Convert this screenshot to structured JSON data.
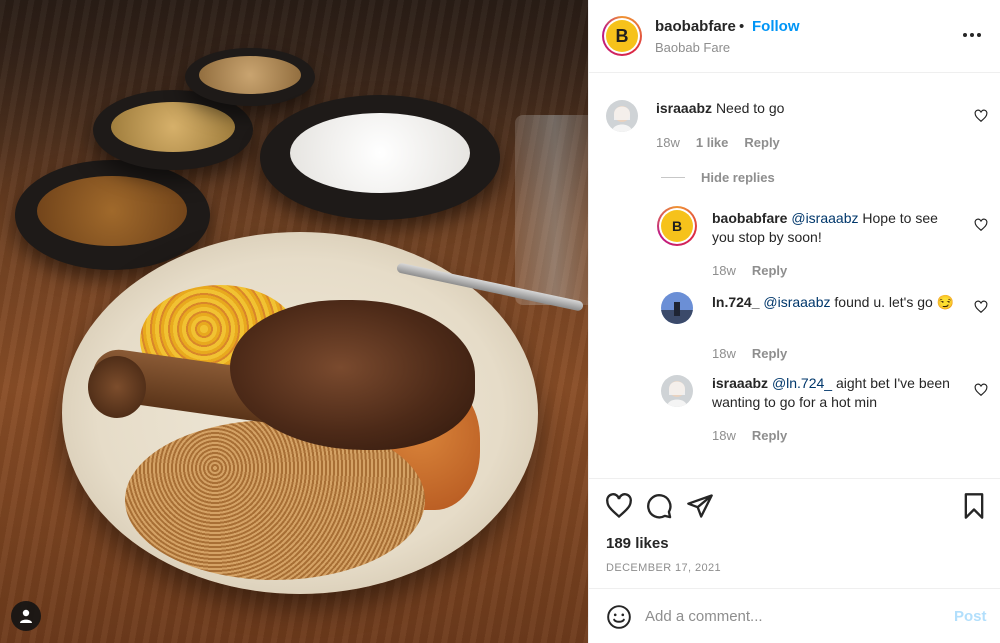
{
  "post": {
    "account": {
      "username": "baobabfare",
      "separator": "•",
      "follow_label": "Follow",
      "subtitle": "Baobab Fare",
      "logo_letter": "B",
      "more_icon": "more-horizontal-icon"
    },
    "comments": [
      {
        "username": "israaabz",
        "text": "Need to go",
        "age": "18w",
        "likes": "1 like",
        "reply_label": "Reply"
      }
    ],
    "hide_replies_label": "Hide replies",
    "replies": [
      {
        "username": "baobabfare",
        "mention": "@israaabz",
        "text": "Hope to see you stop by soon!",
        "age": "18w",
        "reply_label": "Reply"
      },
      {
        "username": "ln.724_",
        "mention": "@israaabz",
        "text": "found u. let's go 😏",
        "age": "18w",
        "reply_label": "Reply"
      },
      {
        "username": "israaabz",
        "mention": "@ln.724_",
        "text": "aight bet I've been wanting to go for a hot min",
        "age": "18w",
        "reply_label": "Reply"
      }
    ],
    "likes_count": "189 likes",
    "date": "DECEMBER 17, 2021",
    "add_comment_placeholder": "Add a comment...",
    "post_label": "Post"
  },
  "colors": {
    "accent": "#0095f6",
    "mention": "#00376b",
    "muted": "#8e8e8e",
    "post_disabled": "#b2dffc",
    "brand_yellow": "#f6c21b"
  }
}
